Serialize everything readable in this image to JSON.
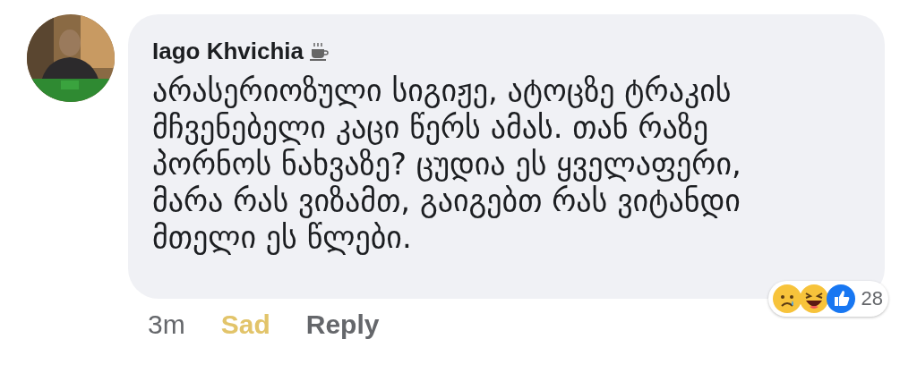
{
  "comment": {
    "author": "Iago Khvichia",
    "author_badge": {
      "kind": "coffee"
    },
    "text": "არასერიოზული სიგიჟე, ატოცზე ტრაკის\nმჩვენებელი კაცი წერს ამას. თან რაზე\nპორნოს ნახვაზე?  ცუდია ეს ყველაფერი,\nმარა რას ვიზამთ, გაიგებთ რას ვიტანდი\nმთელი ეს წლები.",
    "time": "3m",
    "my_reaction": {
      "label": "Sad",
      "kind": "sad"
    },
    "reply": "Reply",
    "reactions": {
      "items": [
        {
          "kind": "sad"
        },
        {
          "kind": "haha"
        },
        {
          "kind": "like"
        }
      ],
      "count": "28"
    }
  }
}
